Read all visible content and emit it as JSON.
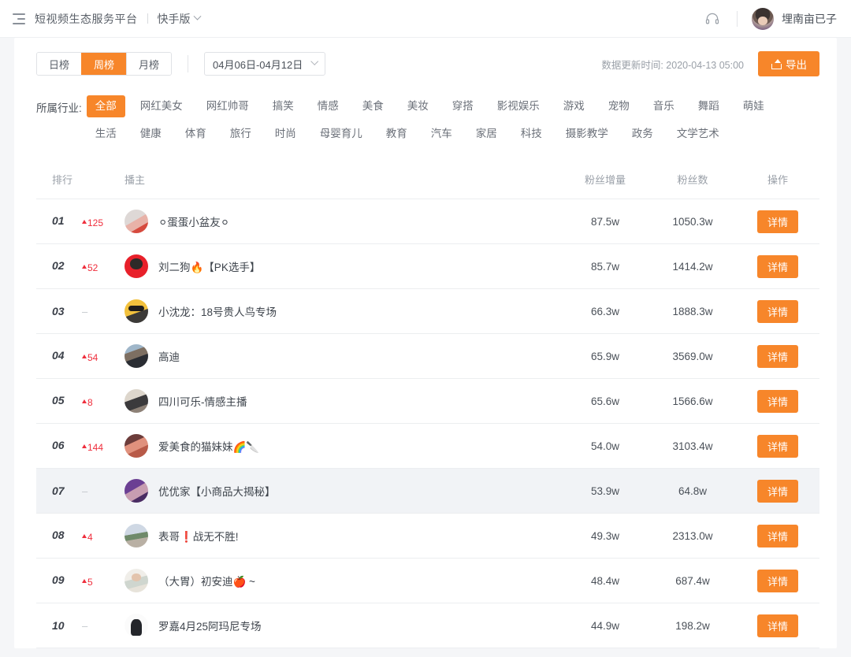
{
  "header": {
    "menu_icon": "hamburger-list-icon",
    "app_title": "短视频生态服务平台",
    "edition": "快手版",
    "support_icon": "headset-icon",
    "username": "埋南亩已子"
  },
  "controls": {
    "period_tabs": [
      {
        "label": "日榜",
        "active": false
      },
      {
        "label": "周榜",
        "active": true
      },
      {
        "label": "月榜",
        "active": false
      }
    ],
    "date_range": "04月06日-04月12日",
    "update_time": "数据更新时间: 2020-04-13 05:00",
    "export_label": "导出",
    "export_icon": "upload-icon"
  },
  "filters": {
    "label": "所属行业:",
    "tags": [
      {
        "label": "全部",
        "active": true
      },
      {
        "label": "网红美女",
        "active": false
      },
      {
        "label": "网红帅哥",
        "active": false
      },
      {
        "label": "搞笑",
        "active": false
      },
      {
        "label": "情感",
        "active": false
      },
      {
        "label": "美食",
        "active": false
      },
      {
        "label": "美妆",
        "active": false
      },
      {
        "label": "穿搭",
        "active": false
      },
      {
        "label": "影视娱乐",
        "active": false
      },
      {
        "label": "游戏",
        "active": false
      },
      {
        "label": "宠物",
        "active": false
      },
      {
        "label": "音乐",
        "active": false
      },
      {
        "label": "舞蹈",
        "active": false
      },
      {
        "label": "萌娃",
        "active": false
      },
      {
        "label": "生活",
        "active": false
      },
      {
        "label": "健康",
        "active": false
      },
      {
        "label": "体育",
        "active": false
      },
      {
        "label": "旅行",
        "active": false
      },
      {
        "label": "时尚",
        "active": false
      },
      {
        "label": "母婴育儿",
        "active": false
      },
      {
        "label": "教育",
        "active": false
      },
      {
        "label": "汽车",
        "active": false
      },
      {
        "label": "家居",
        "active": false
      },
      {
        "label": "科技",
        "active": false
      },
      {
        "label": "摄影教学",
        "active": false
      },
      {
        "label": "政务",
        "active": false
      },
      {
        "label": "文学艺术",
        "active": false
      }
    ]
  },
  "table": {
    "columns": {
      "rank": "排行",
      "host": "播主",
      "increase": "粉丝增量",
      "fans": "粉丝数",
      "action": "操作"
    },
    "detail_label": "详情",
    "rows": [
      {
        "rank": "01",
        "delta": "125",
        "delta_dir": "up",
        "name": "⚪蛋蛋小盆友⚪",
        "increase": "87.5w",
        "fans": "1050.3w",
        "avatar": "av-a",
        "hover": false
      },
      {
        "rank": "02",
        "delta": "52",
        "delta_dir": "up",
        "name": "刘二狗🔥【PK选手】",
        "increase": "85.7w",
        "fans": "1414.2w",
        "avatar": "av-b",
        "hover": false
      },
      {
        "rank": "03",
        "delta": "",
        "delta_dir": "flat",
        "name": "小沈龙：18号贵人鸟专场",
        "increase": "66.3w",
        "fans": "1888.3w",
        "avatar": "av-c",
        "hover": false
      },
      {
        "rank": "04",
        "delta": "54",
        "delta_dir": "up",
        "name": "高迪",
        "increase": "65.9w",
        "fans": "3569.0w",
        "avatar": "av-d",
        "hover": false
      },
      {
        "rank": "05",
        "delta": "8",
        "delta_dir": "up",
        "name": "四川可乐-情感主播",
        "increase": "65.6w",
        "fans": "1566.6w",
        "avatar": "av-e",
        "hover": false
      },
      {
        "rank": "06",
        "delta": "144",
        "delta_dir": "up",
        "name": "爱美食的猫妹妹🌈🔪",
        "increase": "54.0w",
        "fans": "3103.4w",
        "avatar": "av-f",
        "hover": false
      },
      {
        "rank": "07",
        "delta": "",
        "delta_dir": "flat",
        "name": "优优家【小商品大揭秘】",
        "increase": "53.9w",
        "fans": "64.8w",
        "avatar": "av-g",
        "hover": true
      },
      {
        "rank": "08",
        "delta": "4",
        "delta_dir": "up",
        "name": "表哥❗战无不胜!",
        "increase": "49.3w",
        "fans": "2313.0w",
        "avatar": "av-h",
        "hover": false
      },
      {
        "rank": "09",
        "delta": "5",
        "delta_dir": "up",
        "name": "（大胃）初安迪🍎 ~",
        "increase": "48.4w",
        "fans": "687.4w",
        "avatar": "av-i",
        "hover": false
      },
      {
        "rank": "10",
        "delta": "",
        "delta_dir": "flat",
        "name": "罗嘉4月25阿玛尼专场",
        "increase": "44.9w",
        "fans": "198.2w",
        "avatar": "av-j",
        "hover": false
      }
    ]
  },
  "colors": {
    "accent": "#f7862a",
    "rank_delta": "#ef2e3c",
    "text": "#3e444c",
    "muted": "#9aa0a8"
  }
}
